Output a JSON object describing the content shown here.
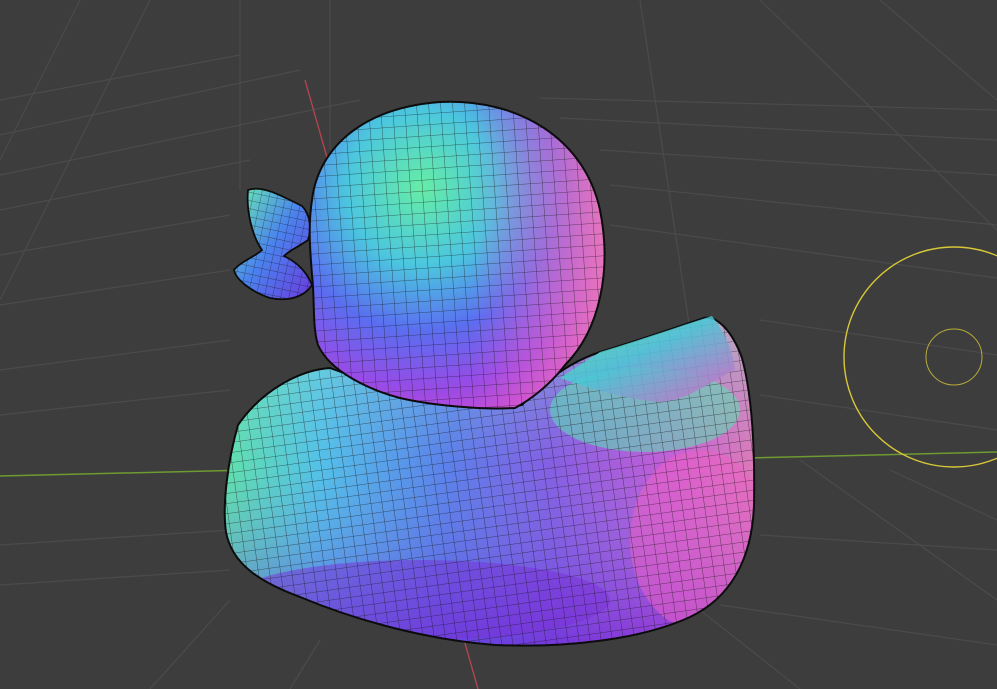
{
  "viewport": {
    "background": "#3d3d3d",
    "grid_color": "#4a4a4a",
    "x_axis_color": "#b8454f",
    "y_axis_color": "#6e9a32"
  },
  "scene": {
    "object": "rubber-duck-mesh",
    "shading": "normal-map",
    "wireframe": true,
    "colors": {
      "green": "#63f0a0",
      "cyan": "#4fc3e8",
      "blue": "#4c62ee",
      "violet": "#7a3ae6",
      "magenta": "#e64fd0",
      "pink": "#f06fb0",
      "edge": "#121212"
    }
  },
  "light_gizmo": {
    "color": "#d8c838"
  }
}
